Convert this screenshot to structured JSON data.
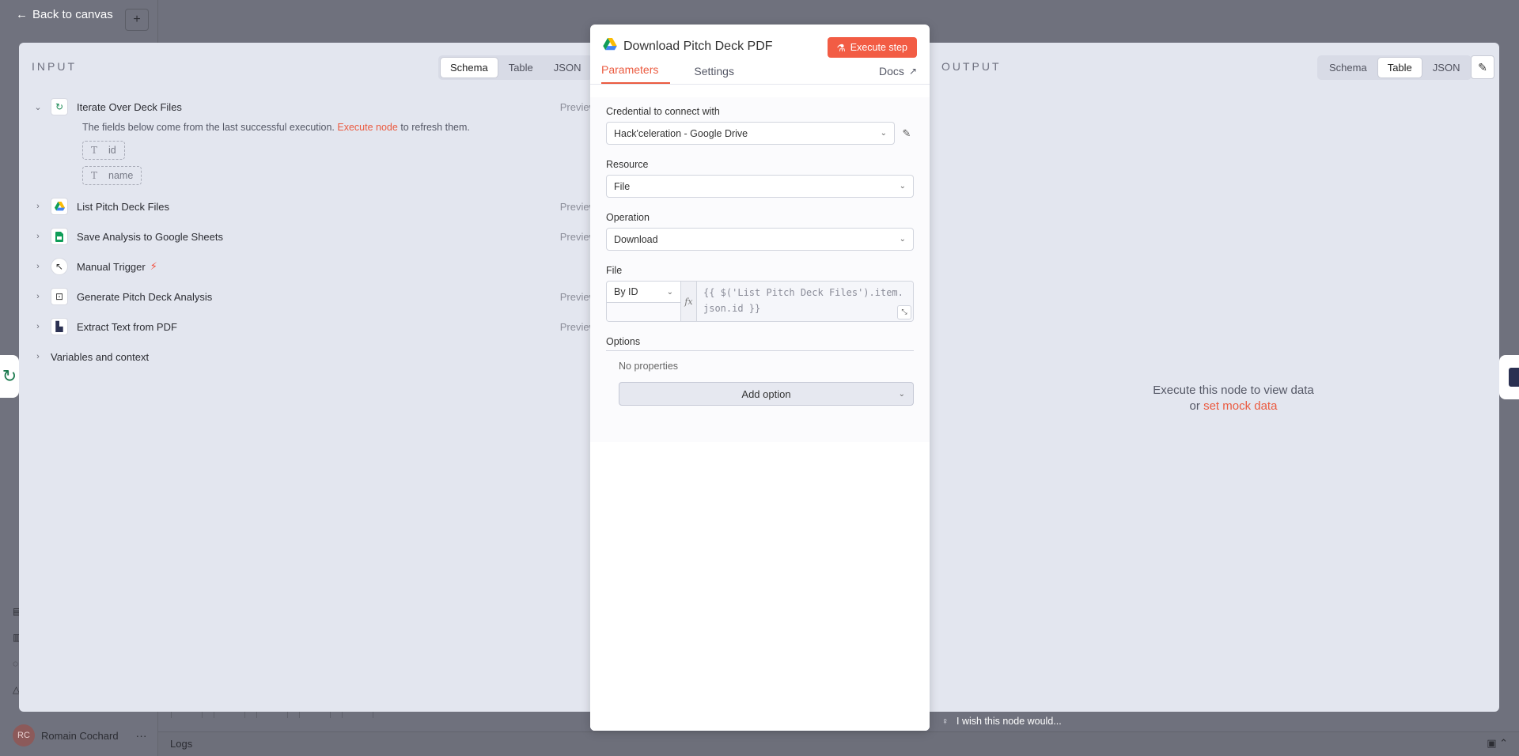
{
  "nav": {
    "back_label": "Back to canvas"
  },
  "user": {
    "initials": "RC",
    "name": "Romain Cochard"
  },
  "logs": {
    "label": "Logs"
  },
  "input": {
    "title": "INPUT",
    "view_tabs": [
      "Schema",
      "Table",
      "JSON"
    ],
    "active_view": "Schema",
    "nodes": [
      {
        "name": "Iterate Over Deck Files",
        "icon": "loop-icon",
        "preview": "Preview",
        "expanded": true
      },
      {
        "name": "List Pitch Deck Files",
        "icon": "google-drive-icon",
        "preview": "Preview"
      },
      {
        "name": "Save Analysis to Google Sheets",
        "icon": "google-sheets-icon",
        "preview": "Preview"
      },
      {
        "name": "Manual Trigger",
        "icon": "cursor-icon",
        "preview": ""
      },
      {
        "name": "Generate Pitch Deck Analysis",
        "icon": "robot-icon",
        "preview": "Preview"
      },
      {
        "name": "Extract Text from PDF",
        "icon": "pdf-extract-icon",
        "preview": "Preview"
      }
    ],
    "note_prefix": "The fields below come from the last successful execution.",
    "note_link": "Execute node",
    "note_suffix": "to refresh them.",
    "fields": [
      "id",
      "name"
    ],
    "variables_label": "Variables and context"
  },
  "output": {
    "title": "OUTPUT",
    "view_tabs": [
      "Schema",
      "Table",
      "JSON"
    ],
    "active_view": "Table",
    "empty_line1": "Execute this node to view data",
    "empty_or": "or",
    "empty_link": "set mock data"
  },
  "node": {
    "title": "Download Pitch Deck PDF",
    "execute_label": "Execute step",
    "tabs": {
      "parameters": "Parameters",
      "settings": "Settings",
      "docs": "Docs"
    },
    "params": {
      "credential_label": "Credential to connect with",
      "credential_value": "Hack'celeration - Google Drive",
      "resource_label": "Resource",
      "resource_value": "File",
      "operation_label": "Operation",
      "operation_value": "Download",
      "file_label": "File",
      "file_mode": "By ID",
      "file_expression": "{{ $('List Pitch Deck Files').item.json.id }}",
      "options_label": "Options",
      "no_properties": "No properties",
      "add_option": "Add option"
    }
  },
  "feedback": {
    "label": "I wish this node would..."
  },
  "colors": {
    "accent": "#f25c44",
    "link": "#eb5a3f",
    "panel_bg": "#e3e6ef",
    "overlay": "#6f717d"
  }
}
